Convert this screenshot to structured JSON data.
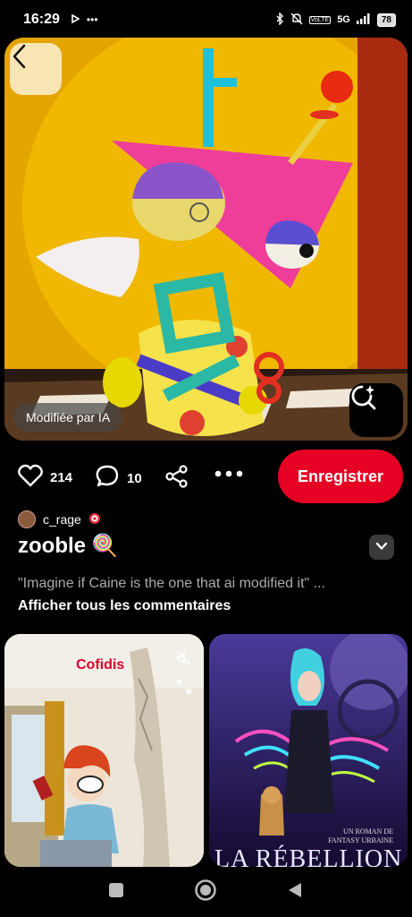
{
  "status_bar": {
    "time": "16:29",
    "left_icons": [
      "play-icon",
      "more-icon"
    ],
    "network": "5G",
    "volte": "VoLTE",
    "battery": "78"
  },
  "pin": {
    "ai_label": "Modifiée par IA",
    "like_count": "214",
    "comment_count": "10",
    "save_label": "Enregistrer",
    "author": "c_rage",
    "title": "zooble",
    "title_emoji": "🍭",
    "description": "\"Imagine if Caine is the one that ai modified it\" ...",
    "show_comments": "Afficher tous les commentaires"
  },
  "related": [
    {
      "brand": "Cofidis"
    },
    {
      "subtitle_line1": "UN ROMAN DE",
      "subtitle_line2": "FANTASY URBAINE",
      "title": "LA RÉBELLION"
    }
  ],
  "colors": {
    "accent": "#e60023",
    "background": "#000000"
  }
}
